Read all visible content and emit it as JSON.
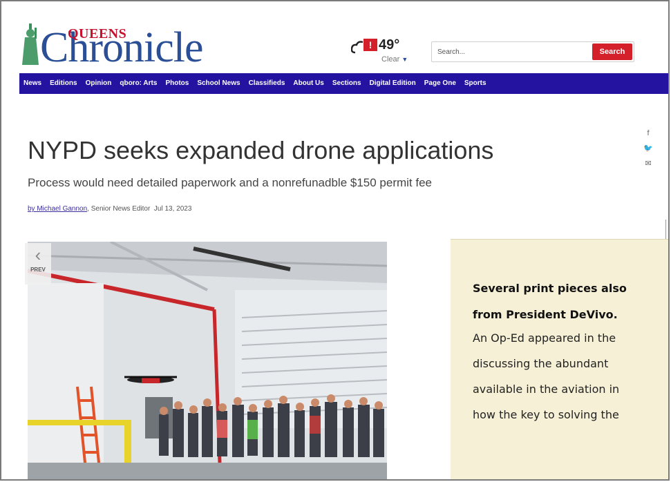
{
  "logo": {
    "top_text": "QUEENS",
    "main_text": "Chronicle"
  },
  "weather": {
    "alert": "!",
    "temp": "49°",
    "condition": "Clear"
  },
  "search": {
    "placeholder": "Search...",
    "button": "Search"
  },
  "nav": {
    "items": [
      "News",
      "Editions",
      "Opinion",
      "qboro: Arts",
      "Photos",
      "School News",
      "Classifieds",
      "About Us",
      "Sections",
      "Digital Edition",
      "Page One",
      "Sports"
    ]
  },
  "share": {
    "icons": [
      "facebook-icon",
      "twitter-icon",
      "email-icon"
    ]
  },
  "article": {
    "headline": "NYPD seeks expanded drone applications",
    "subhead": "Process would need detailed paperwork and a nonrefunadble $150 permit fee",
    "author": "by Michael Gannon",
    "role": ", Senior News Editor",
    "date": "Jul 13, 2023"
  },
  "gallery": {
    "prev_label": "PREV"
  },
  "callout": {
    "bold_lines": [
      "Several print pieces also",
      "from President DeVivo."
    ],
    "body_lines": [
      "An Op-Ed appeared in the",
      "discussing the abundant",
      "available in the aviation in",
      "how the key to solving the"
    ]
  },
  "colors": {
    "nav_bg": "#2413a0",
    "brand_red": "#d3202a",
    "logo_blue": "#2a4f97",
    "callout_bg": "#f6f1d6"
  }
}
